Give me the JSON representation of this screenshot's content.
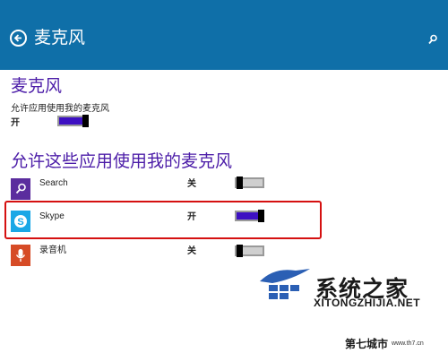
{
  "header": {
    "title": "麦克风"
  },
  "section1": {
    "title": "麦克风",
    "setting_label": "允许应用使用我的麦克风",
    "toggle_state": "开",
    "toggle_on": true
  },
  "section2": {
    "title": "允许这些应用使用我的麦克风",
    "apps": [
      {
        "name": "Search",
        "state": "关",
        "on": false,
        "icon": "search-icon",
        "icon_color": "#5b2d9e"
      },
      {
        "name": "Skype",
        "state": "开",
        "on": true,
        "icon": "skype-icon",
        "icon_color": "#1aa7e6"
      },
      {
        "name": "录音机",
        "state": "关",
        "on": false,
        "icon": "microphone-icon",
        "icon_color": "#d64b26"
      }
    ]
  },
  "watermark": {
    "brand": "系统之家",
    "url": "XITONGZHIJIA.NET",
    "corner_brand": "第七城市",
    "corner_url": "www.th7.cn"
  },
  "colors": {
    "header": "#0f6fa8",
    "accent": "#4c1da8",
    "toggle_fill": "#3d10c2",
    "highlight": "#d51010"
  }
}
